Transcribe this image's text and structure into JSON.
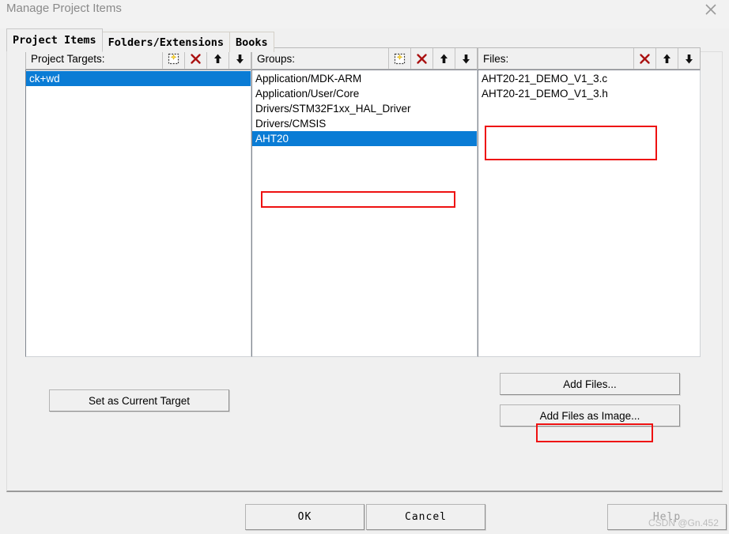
{
  "window": {
    "title": "Manage Project Items",
    "close_icon": "close-icon"
  },
  "tabs": [
    {
      "label": "Project Items",
      "selected": true
    },
    {
      "label": "Folders/Extensions",
      "selected": false
    },
    {
      "label": "Books",
      "selected": false
    }
  ],
  "columns": {
    "targets": {
      "label": "Project Targets:",
      "buttons": [
        {
          "icon": "new-item-icon",
          "name": "new-target-button"
        },
        {
          "icon": "delete-x-icon",
          "name": "delete-target-button"
        },
        {
          "icon": "arrow-up-icon",
          "name": "move-target-up-button"
        },
        {
          "icon": "arrow-down-icon",
          "name": "move-target-down-button"
        }
      ],
      "items": [
        {
          "label": "ck+wd",
          "selected": true
        }
      ]
    },
    "groups": {
      "label": "Groups:",
      "buttons": [
        {
          "icon": "new-item-icon",
          "name": "new-group-button"
        },
        {
          "icon": "delete-x-icon",
          "name": "delete-group-button"
        },
        {
          "icon": "arrow-up-icon",
          "name": "move-group-up-button"
        },
        {
          "icon": "arrow-down-icon",
          "name": "move-group-down-button"
        }
      ],
      "items": [
        {
          "label": "Application/MDK-ARM",
          "selected": false
        },
        {
          "label": "Application/User/Core",
          "selected": false
        },
        {
          "label": "Drivers/STM32F1xx_HAL_Driver",
          "selected": false
        },
        {
          "label": "Drivers/CMSIS",
          "selected": false
        },
        {
          "label": "AHT20",
          "selected": true
        }
      ]
    },
    "files": {
      "label": "Files:",
      "buttons": [
        {
          "icon": "delete-x-icon",
          "name": "delete-file-button"
        },
        {
          "icon": "arrow-up-icon",
          "name": "move-file-up-button"
        },
        {
          "icon": "arrow-down-icon",
          "name": "move-file-down-button"
        }
      ],
      "items": [
        {
          "label": "AHT20-21_DEMO_V1_3.c",
          "selected": false
        },
        {
          "label": "AHT20-21_DEMO_V1_3.h",
          "selected": false
        }
      ]
    }
  },
  "buttons": {
    "set_as_current_target": "Set as Current Target",
    "add_files": "Add Files...",
    "add_files_as_image": "Add Files as Image...",
    "ok": "OK",
    "cancel": "Cancel",
    "help": "Help"
  },
  "watermark": "CSDN @Gn.452",
  "colors": {
    "selection_blue": "#0a7cd5",
    "annotation_red": "#ee1111",
    "dialog_bg": "#f0f0f0",
    "delete_icon_red": "#aa1111"
  }
}
